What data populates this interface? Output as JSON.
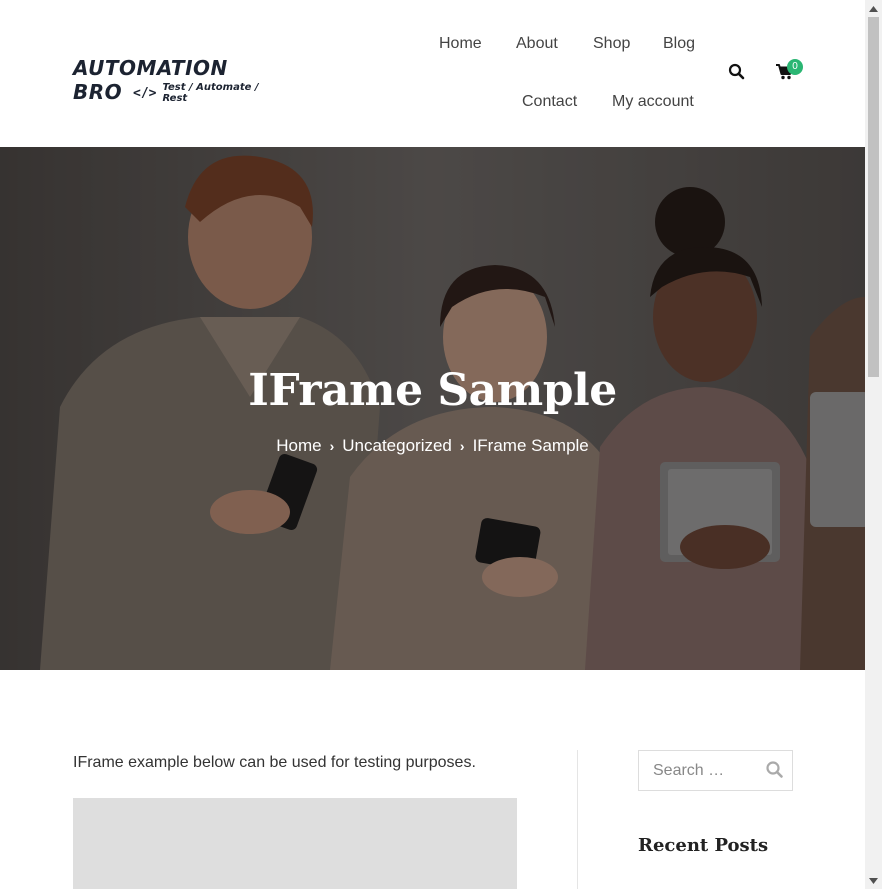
{
  "header": {
    "logo": {
      "title": "AUTOMATION BRO",
      "code_glyph": "</>",
      "tagline": "Test / Automate / Rest"
    },
    "nav": {
      "home": "Home",
      "about": "About",
      "shop": "Shop",
      "blog": "Blog",
      "contact": "Contact",
      "my_account": "My account"
    },
    "icons": {
      "search": "search-icon",
      "cart": "cart-icon"
    },
    "cart_count": "0"
  },
  "hero": {
    "title": "IFrame Sample",
    "breadcrumb": [
      "Home",
      "Uncategorized",
      "IFrame Sample"
    ],
    "separator": "›"
  },
  "content": {
    "intro": "IFrame example below can be used for testing purposes."
  },
  "sidebar": {
    "search_placeholder": "Search …",
    "recent_posts_title": "Recent Posts"
  },
  "colors": {
    "accent": "#2bb673",
    "logo": "#1c2331",
    "nav_text": "#444444",
    "iframe_placeholder": "#dedede"
  }
}
